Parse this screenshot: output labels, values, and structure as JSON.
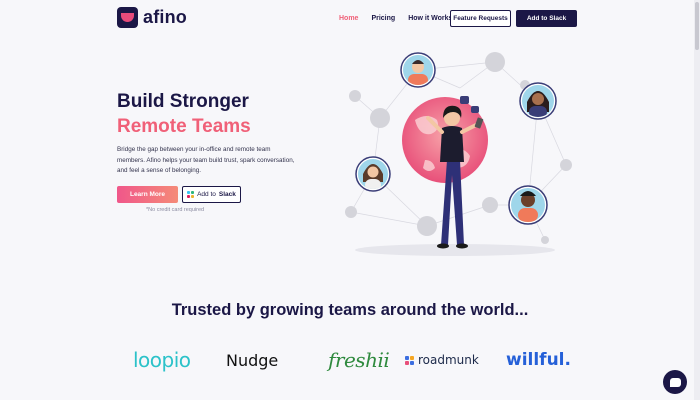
{
  "nav": {
    "logo_text": "afino",
    "links": [
      "Home",
      "Pricing",
      "How it Works"
    ],
    "active_link": "Home",
    "feature_requests": "Feature Requests",
    "add_to_slack": "Add to Slack"
  },
  "hero": {
    "title_line1": "Build Stronger",
    "title_line2": "Remote Teams",
    "description": "Bridge the gap between your in-office and remote team members. Afino helps your team build trust, spark conversation, and feel a sense of belonging.",
    "learn_more": "Learn More",
    "add_prefix": "Add to",
    "add_brand": "Slack",
    "no_card": "*No credit card required"
  },
  "trusted": {
    "heading": "Trusted by growing teams around the world...",
    "logos": [
      "loopio",
      "Nudge",
      "freshii",
      "roadmunk",
      "willful."
    ]
  },
  "colors": {
    "navy": "#1b1746",
    "accent_pink": "#f06078",
    "background": "#f7f7fa"
  },
  "icons": [
    "logo-mark-icon",
    "slack-icon",
    "roadmunk-icon",
    "chat-icon"
  ]
}
